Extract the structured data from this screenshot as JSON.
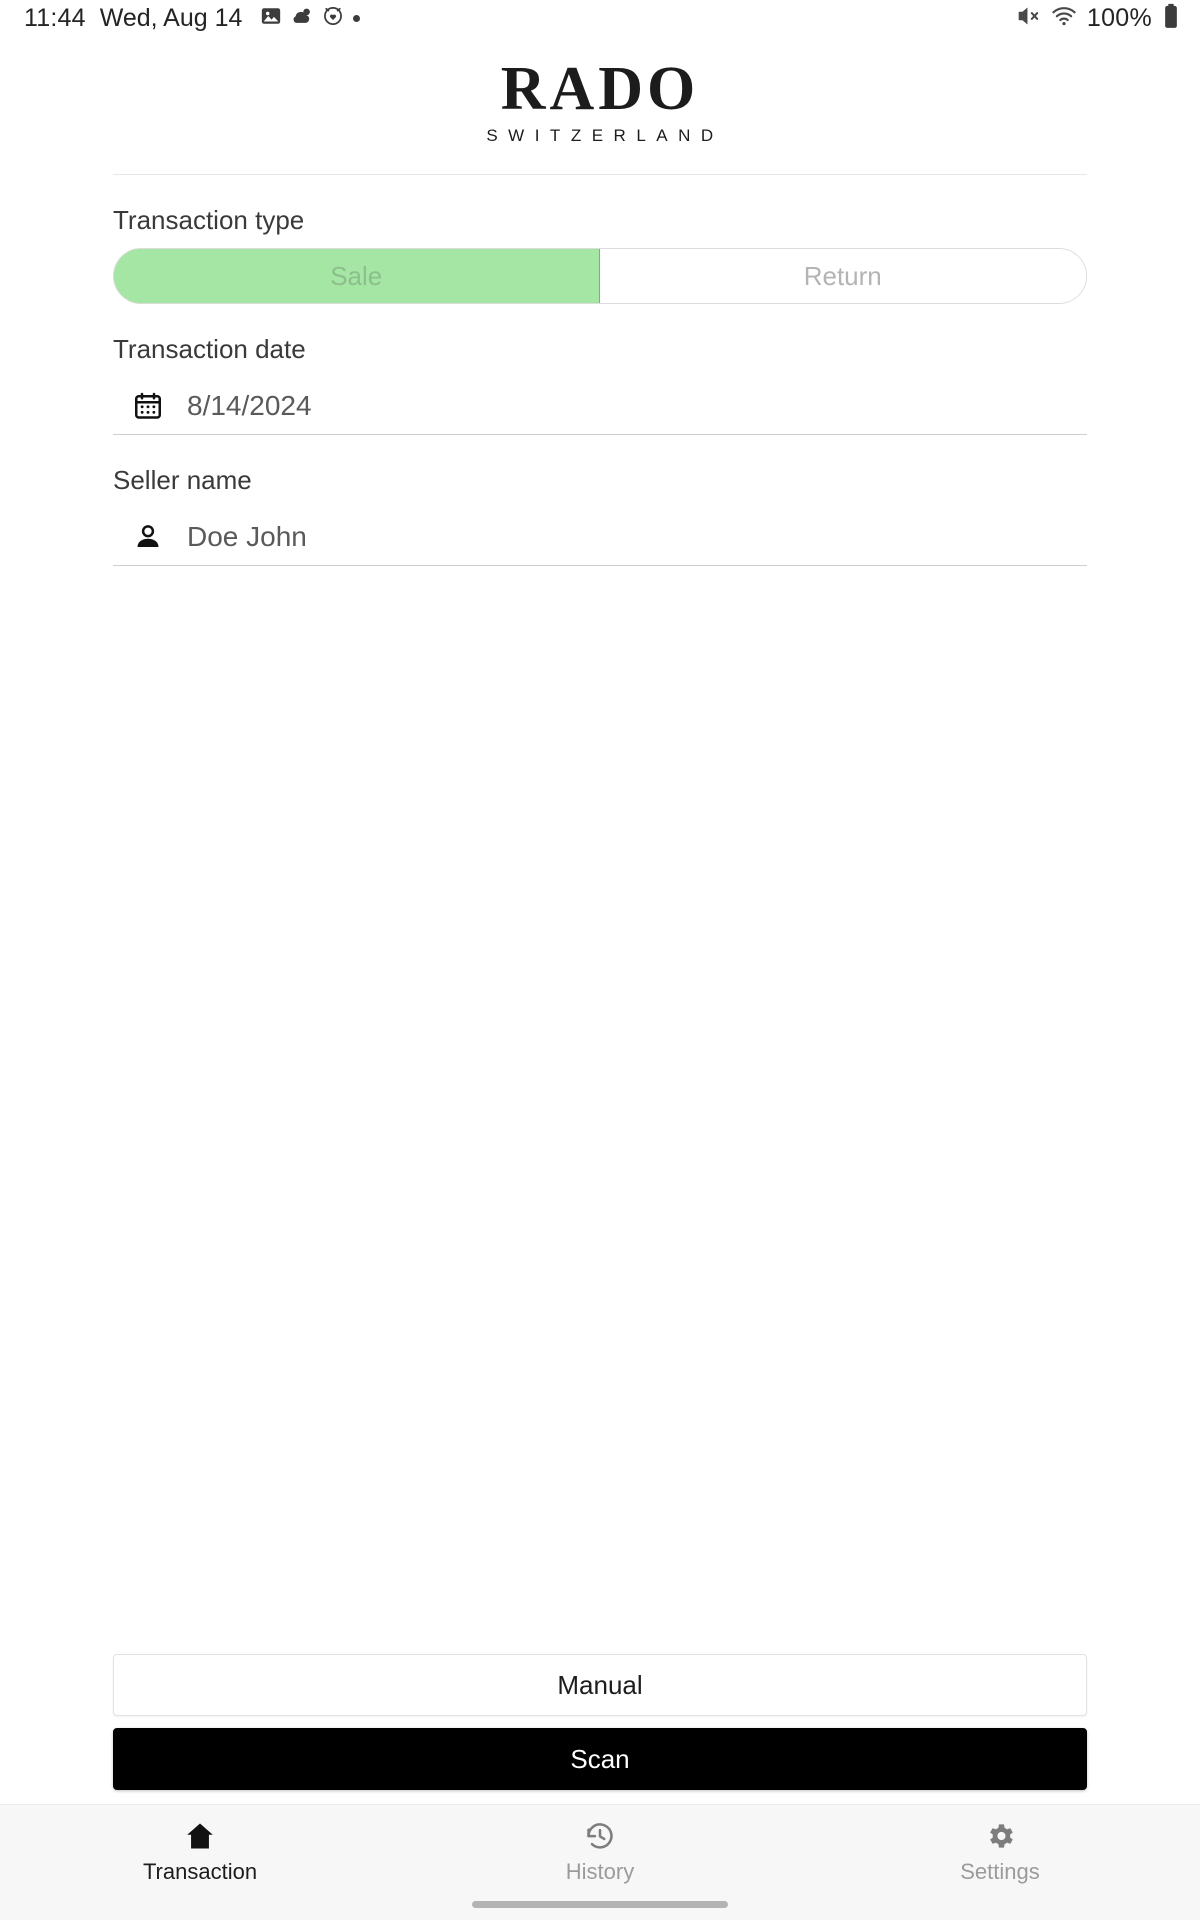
{
  "status_bar": {
    "time": "11:44",
    "date": "Wed, Aug 14",
    "battery_percent": "100%",
    "icons_left": [
      "photo-icon",
      "weather-partly-cloudy-icon",
      "alarm-heart-icon",
      "dot-icon"
    ],
    "icons_right": [
      "mute-icon",
      "wifi-icon",
      "battery-icon"
    ]
  },
  "header": {
    "brand": "RADO",
    "brand_subtitle": "SWITZERLAND"
  },
  "form": {
    "transaction_type": {
      "label": "Transaction type",
      "options": [
        "Sale",
        "Return"
      ],
      "selected": "Sale",
      "selected_bg": "#a5e6a5",
      "selected_border": "#5cc45c"
    },
    "transaction_date": {
      "label": "Transaction date",
      "value": "8/14/2024",
      "icon": "calendar-icon"
    },
    "seller_name": {
      "label": "Seller name",
      "value": "Doe John",
      "icon": "person-icon"
    }
  },
  "actions": {
    "manual_label": "Manual",
    "scan_label": "Scan",
    "scan_bg": "#000000"
  },
  "bottom_nav": {
    "items": [
      {
        "label": "Transaction",
        "icon": "home-icon",
        "active": true
      },
      {
        "label": "History",
        "icon": "history-clock-icon",
        "active": false
      },
      {
        "label": "Settings",
        "icon": "gear-icon",
        "active": false
      }
    ]
  }
}
